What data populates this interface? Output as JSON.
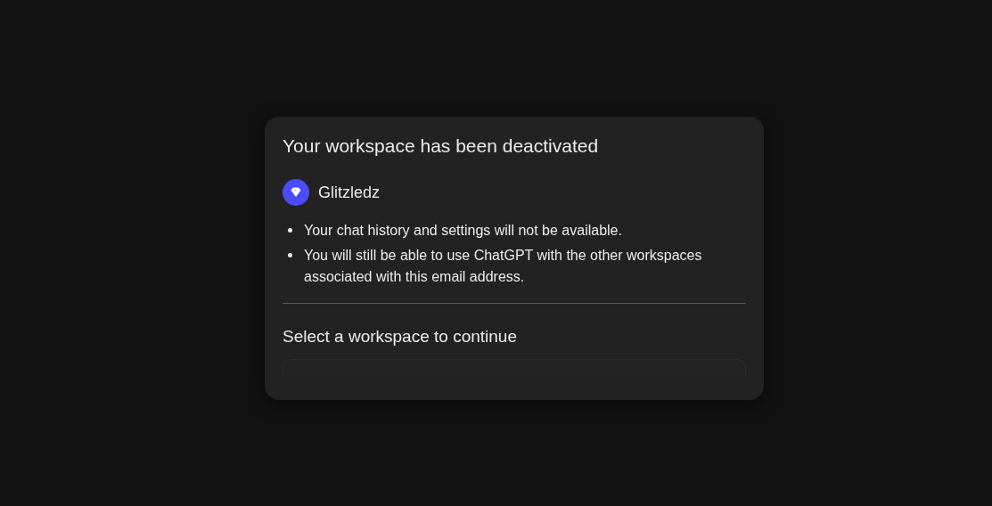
{
  "dialog": {
    "title": "Your workspace has been deactivated",
    "workspace": {
      "name": "Glitzledz",
      "color": "#4c4cff"
    },
    "notes": [
      "Your chat history and settings will not be available.",
      "You will still be able to use ChatGPT with the other workspaces associated with this email address."
    ],
    "prompt": "Select a workspace to continue"
  }
}
